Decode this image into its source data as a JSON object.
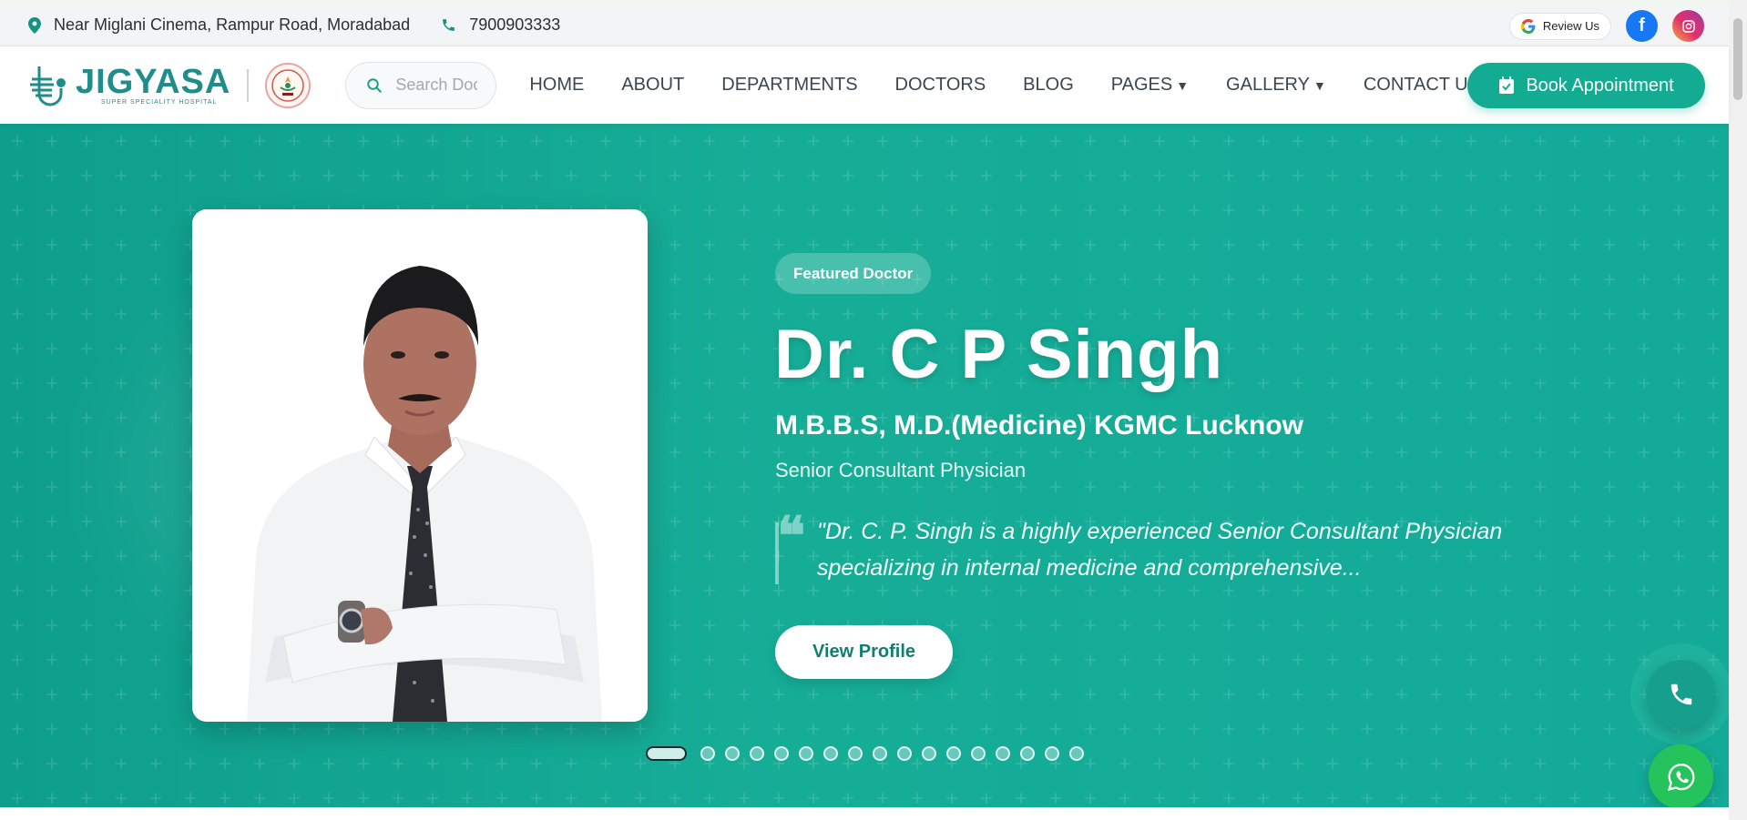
{
  "topbar": {
    "address": "Near Miglani Cinema, Rampur Road, Moradabad",
    "phone": "7900903333",
    "review_label": "Review Us",
    "facebook_icon": "f"
  },
  "brand": {
    "name": "JIGYASA",
    "tagline": "SUPER SPECIALITY HOSPITAL"
  },
  "search": {
    "placeholder": "Search Doctors"
  },
  "nav": {
    "home": "HOME",
    "about": "ABOUT",
    "departments": "DEPARTMENTS",
    "doctors": "DOCTORS",
    "blog": "BLOG",
    "pages": "PAGES",
    "gallery": "GALLERY",
    "contact": "CONTACT US",
    "caret": "▼",
    "book": "Book Appointment"
  },
  "hero": {
    "badge": "Featured Doctor",
    "name": "Dr. C P Singh",
    "qualification": "M.B.B.S, M.D.(Medicine) KGMC Lucknow",
    "role": "Senior Consultant Physician",
    "quote_mark": "❝",
    "quote": "\"Dr. C. P. Singh is a highly experienced Senior Consultant Physician specializing in internal medicine and comprehensive...",
    "view_profile": "View Profile",
    "slide_active": 1,
    "slide_total": 17
  },
  "colors": {
    "brand_teal": "#13ab91",
    "hero_bg": "#16ad97",
    "whatsapp": "#25c35c",
    "facebook": "#1877f2"
  }
}
